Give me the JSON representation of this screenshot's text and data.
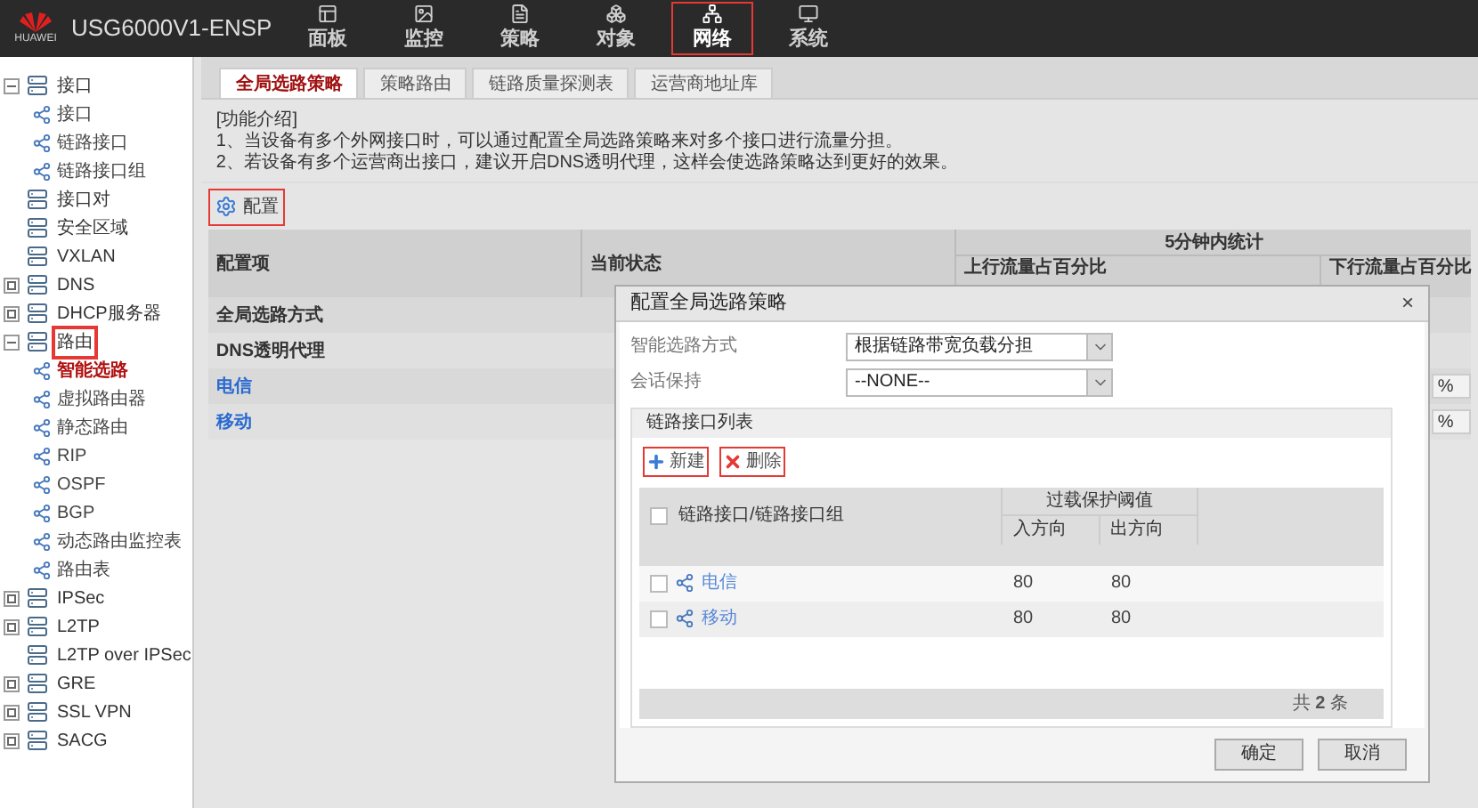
{
  "header": {
    "logo_text": "HUAWEI",
    "product": "USG6000V1-ENSP",
    "nav": [
      {
        "label": "面板",
        "selected": false,
        "highlighted": false
      },
      {
        "label": "监控",
        "selected": false,
        "highlighted": false
      },
      {
        "label": "策略",
        "selected": false,
        "highlighted": false
      },
      {
        "label": "对象",
        "selected": false,
        "highlighted": false
      },
      {
        "label": "网络",
        "selected": true,
        "highlighted": true
      },
      {
        "label": "系统",
        "selected": false,
        "highlighted": false
      }
    ]
  },
  "sidebar": {
    "items": [
      {
        "label": "接口",
        "expanded": true,
        "selected": false,
        "highlighted": false,
        "children": [
          {
            "label": "接口",
            "selected": false
          },
          {
            "label": "链路接口",
            "selected": false
          },
          {
            "label": "链路接口组",
            "selected": false
          }
        ]
      },
      {
        "label": "接口对",
        "selected": false,
        "highlighted": false
      },
      {
        "label": "安全区域",
        "selected": false,
        "highlighted": false
      },
      {
        "label": "VXLAN",
        "selected": false,
        "highlighted": false
      },
      {
        "label": "DNS",
        "expanded": false,
        "selected": false,
        "highlighted": false
      },
      {
        "label": "DHCP服务器",
        "expanded": false,
        "selected": false,
        "highlighted": false
      },
      {
        "label": "路由",
        "expanded": true,
        "selected": false,
        "highlighted": true,
        "children": [
          {
            "label": "智能选路",
            "selected": true
          },
          {
            "label": "虚拟路由器",
            "selected": false
          },
          {
            "label": "静态路由",
            "selected": false
          },
          {
            "label": "RIP",
            "selected": false
          },
          {
            "label": "OSPF",
            "selected": false
          },
          {
            "label": "BGP",
            "selected": false
          },
          {
            "label": "动态路由监控表",
            "selected": false
          },
          {
            "label": "路由表",
            "selected": false
          }
        ]
      },
      {
        "label": "IPSec",
        "expanded": false,
        "selected": false,
        "highlighted": false
      },
      {
        "label": "L2TP",
        "expanded": false,
        "selected": false,
        "highlighted": false
      },
      {
        "label": "L2TP over IPSec",
        "selected": false,
        "highlighted": false
      },
      {
        "label": "GRE",
        "expanded": false,
        "selected": false,
        "highlighted": false
      },
      {
        "label": "SSL VPN",
        "expanded": false,
        "selected": false,
        "highlighted": false
      },
      {
        "label": "SACG",
        "expanded": false,
        "selected": false,
        "highlighted": false
      }
    ]
  },
  "tabs": [
    {
      "label": "全局选路策略",
      "selected": true
    },
    {
      "label": "策略路由",
      "selected": false
    },
    {
      "label": "链路质量探测表",
      "selected": false
    },
    {
      "label": "运营商地址库",
      "selected": false
    }
  ],
  "intro": {
    "title": "[功能介绍]",
    "lines": [
      "1、当设备有多个外网接口时，可以通过配置全局选路策略来对多个接口进行流量分担。",
      "2、若设备有多个运营商出接口，建议开启DNS透明代理，这样会使选路策略达到更好的效果。"
    ]
  },
  "config_button": {
    "label": "配置",
    "highlighted": true
  },
  "table": {
    "columns": [
      "配置项",
      "当前状态"
    ],
    "group": "5分钟内统计",
    "group_columns": [
      "上行流量占百分比",
      "下行流量占百分比"
    ],
    "rows": [
      {
        "kind": "plain",
        "name": "全局选路方式"
      },
      {
        "kind": "plain",
        "name": "DNS透明代理"
      },
      {
        "kind": "link",
        "name": "电信",
        "downlink": "%"
      },
      {
        "kind": "link",
        "name": "移动",
        "downlink": "%"
      }
    ]
  },
  "dialog": {
    "title": "配置全局选路策略",
    "close": "×",
    "fields": [
      {
        "label": "智能选路方式",
        "value": "根据链路带宽负载分担"
      },
      {
        "label": "会话保持",
        "value": "--NONE--"
      }
    ],
    "panel": {
      "title": "链路接口列表",
      "tools": [
        {
          "kind": "add",
          "label": "新建",
          "highlighted": true
        },
        {
          "kind": "delete",
          "label": "删除",
          "highlighted": true
        }
      ],
      "all_checked": false,
      "columns": {
        "name": "链路接口/链路接口组",
        "group": "过载保护阈值",
        "in": "入方向",
        "out": "出方向"
      },
      "rows": [
        {
          "name": "电信",
          "in": "80",
          "out": "80",
          "checked": false
        },
        {
          "name": "移动",
          "in": "80",
          "out": "80",
          "checked": false
        }
      ],
      "footer": "共 **2** 条"
    },
    "buttons": [
      "确定",
      "取消"
    ]
  }
}
